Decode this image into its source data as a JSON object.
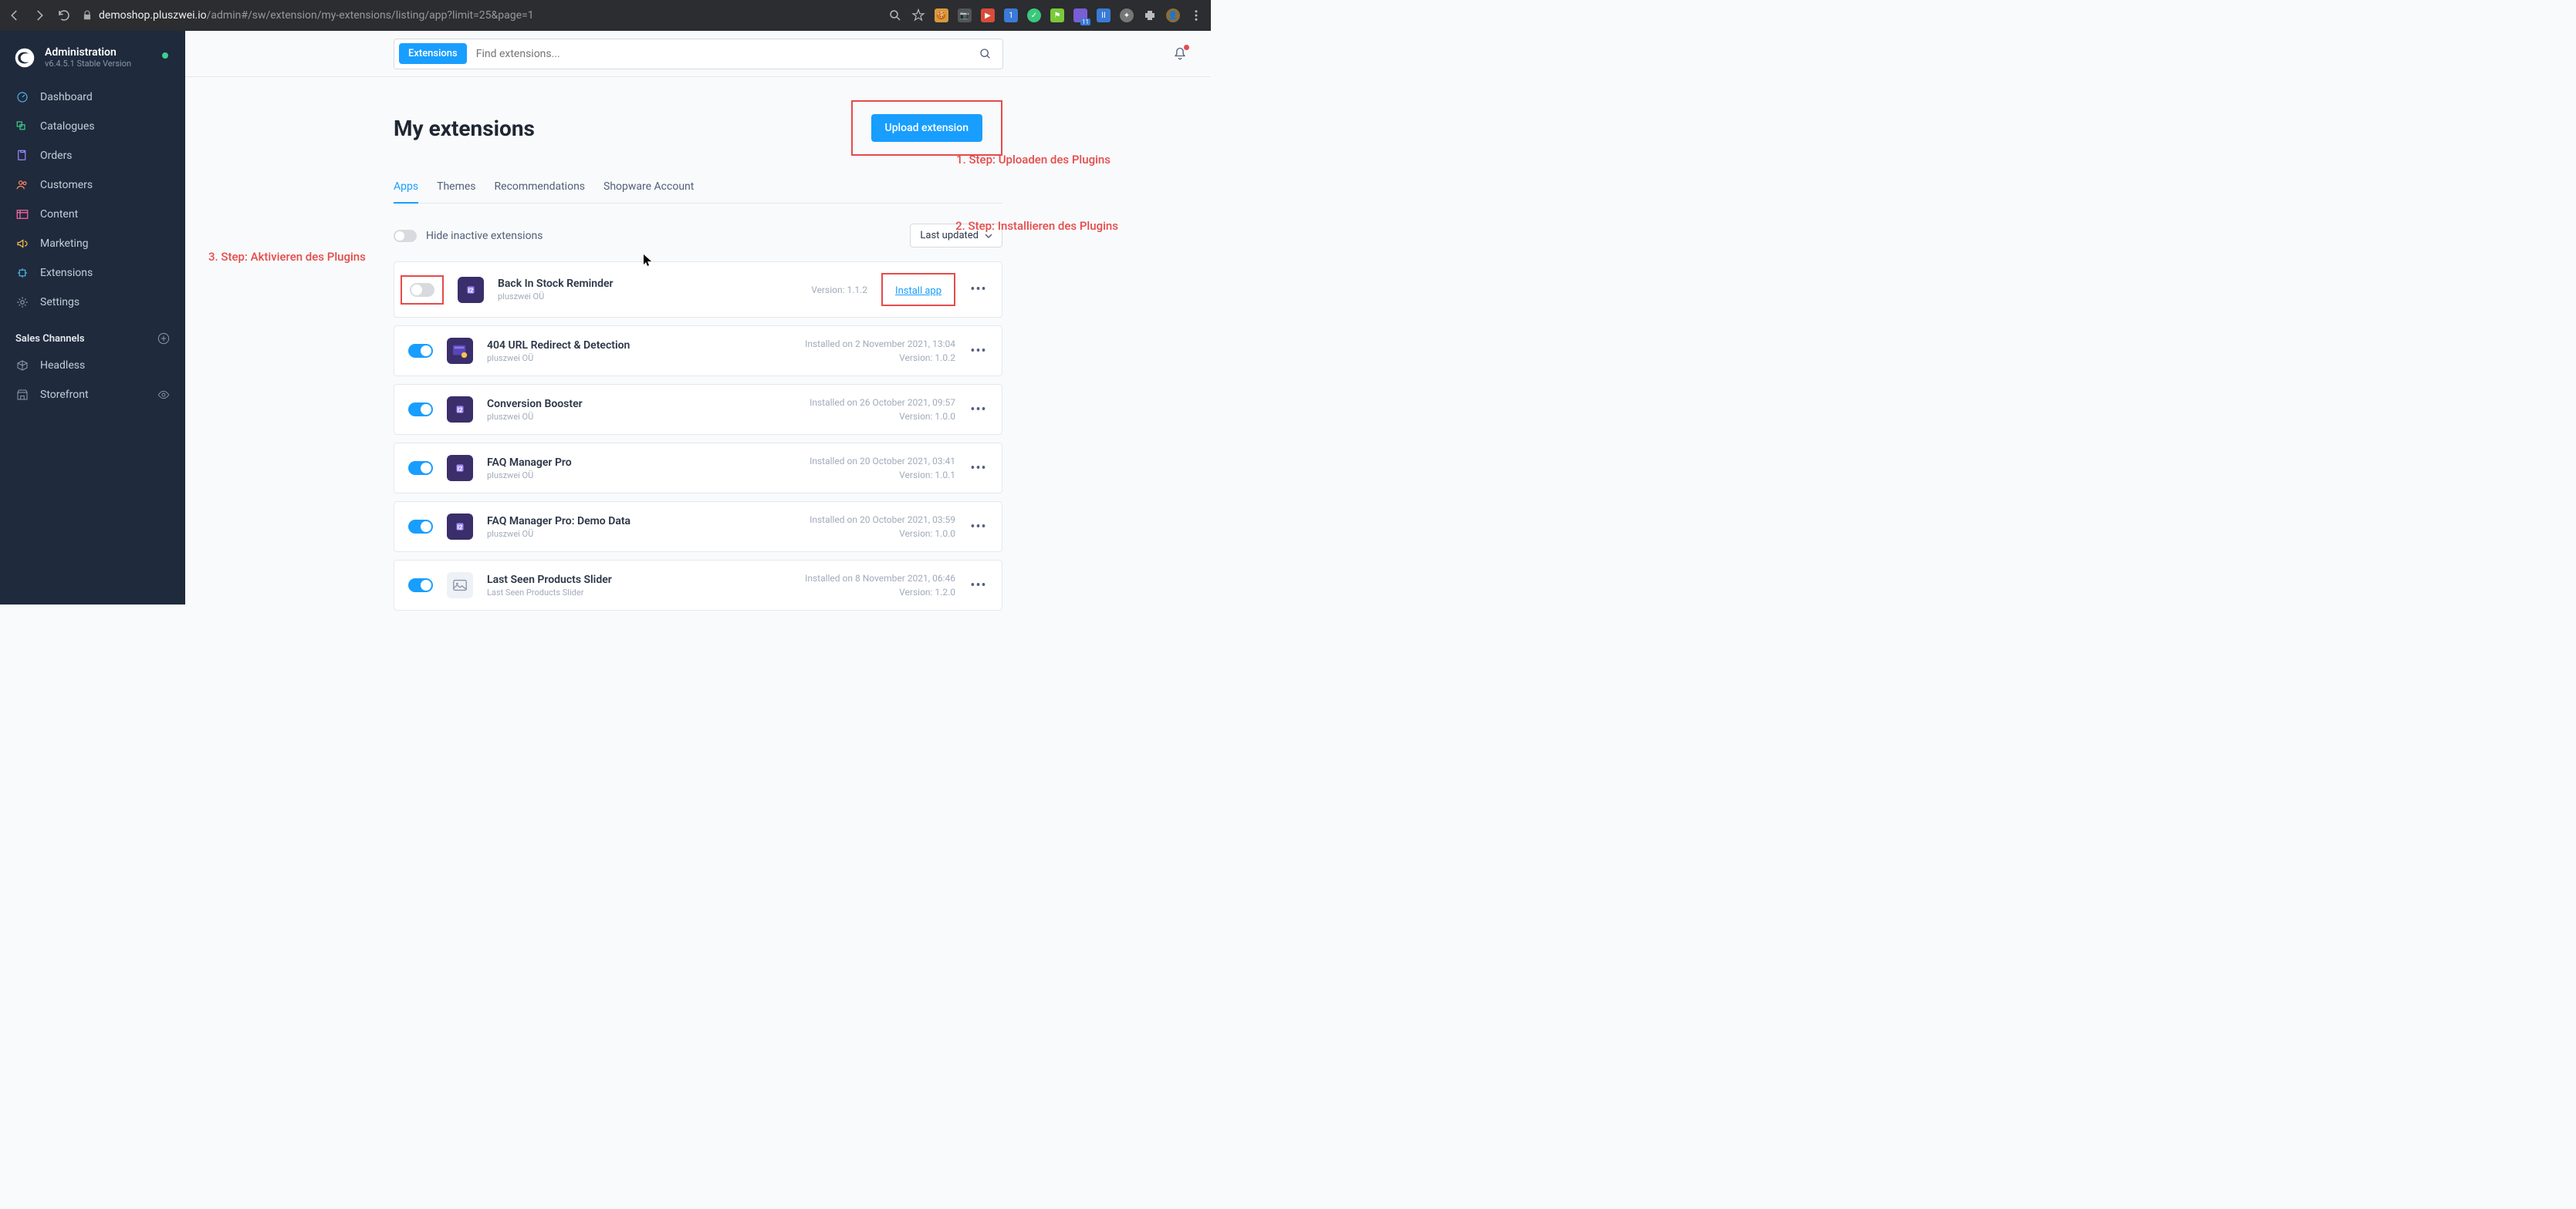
{
  "browser": {
    "url_domain": "demoshop.pluszwei.io",
    "url_path": "/admin#/sw/extension/my-extensions/listing/app?limit=25&page=1",
    "ext_badge": "11"
  },
  "sidebar": {
    "title": "Administration",
    "version": "v6.4.5.1 Stable Version",
    "items": [
      {
        "label": "Dashboard",
        "icon": "dashboard"
      },
      {
        "label": "Catalogues",
        "icon": "catalogues"
      },
      {
        "label": "Orders",
        "icon": "orders"
      },
      {
        "label": "Customers",
        "icon": "customers"
      },
      {
        "label": "Content",
        "icon": "content"
      },
      {
        "label": "Marketing",
        "icon": "marketing"
      },
      {
        "label": "Extensions",
        "icon": "extensions"
      },
      {
        "label": "Settings",
        "icon": "settings"
      }
    ],
    "sales_header": "Sales Channels",
    "sales_items": [
      {
        "label": "Headless",
        "icon": "box"
      },
      {
        "label": "Storefront",
        "icon": "store"
      }
    ]
  },
  "topbar": {
    "search_tag": "Extensions",
    "search_placeholder": "Find extensions..."
  },
  "page": {
    "title": "My extensions",
    "upload_btn": "Upload extension",
    "tabs": [
      "Apps",
      "Themes",
      "Recommendations",
      "Shopware Account"
    ],
    "hide_label": "Hide inactive extensions",
    "sort_label": "Last updated"
  },
  "annotations": {
    "step1": "1. Step: Uploaden des Plugins",
    "step2": "2. Step: Installieren des Plugins",
    "step3": "3. Step: Aktivieren des Plugins"
  },
  "extensions": [
    {
      "name": "Back In Stock Reminder",
      "vendor": "pluszwei OÜ",
      "active": false,
      "installed": "",
      "version": "Version: 1.1.2",
      "install_link": "Install app",
      "highlight": true,
      "icon_color": "#7b5ed6"
    },
    {
      "name": "404 URL Redirect & Detection",
      "vendor": "pluszwei OÜ",
      "active": true,
      "installed": "Installed on 2 November 2021, 13:04",
      "version": "Version: 1.0.2",
      "icon_color": "#6b5dd3"
    },
    {
      "name": "Conversion Booster",
      "vendor": "pluszwei OÜ",
      "active": true,
      "installed": "Installed on 26 October 2021, 09:57",
      "version": "Version: 1.0.0",
      "icon_color": "#7b5ed6"
    },
    {
      "name": "FAQ Manager Pro",
      "vendor": "pluszwei OÜ",
      "active": true,
      "installed": "Installed on 20 October 2021, 03:41",
      "version": "Version: 1.0.1",
      "icon_color": "#7b5ed6"
    },
    {
      "name": "FAQ Manager Pro: Demo Data",
      "vendor": "pluszwei OÜ",
      "active": true,
      "installed": "Installed on 20 October 2021, 03:59",
      "version": "Version: 1.0.0",
      "icon_color": "#7b5ed6"
    },
    {
      "name": "Last Seen Products Slider",
      "vendor": "Last Seen Products Slider",
      "active": true,
      "installed": "Installed on 8 November 2021, 06:46",
      "version": "Version: 1.2.0",
      "icon_color": "#c4cdd9"
    }
  ]
}
